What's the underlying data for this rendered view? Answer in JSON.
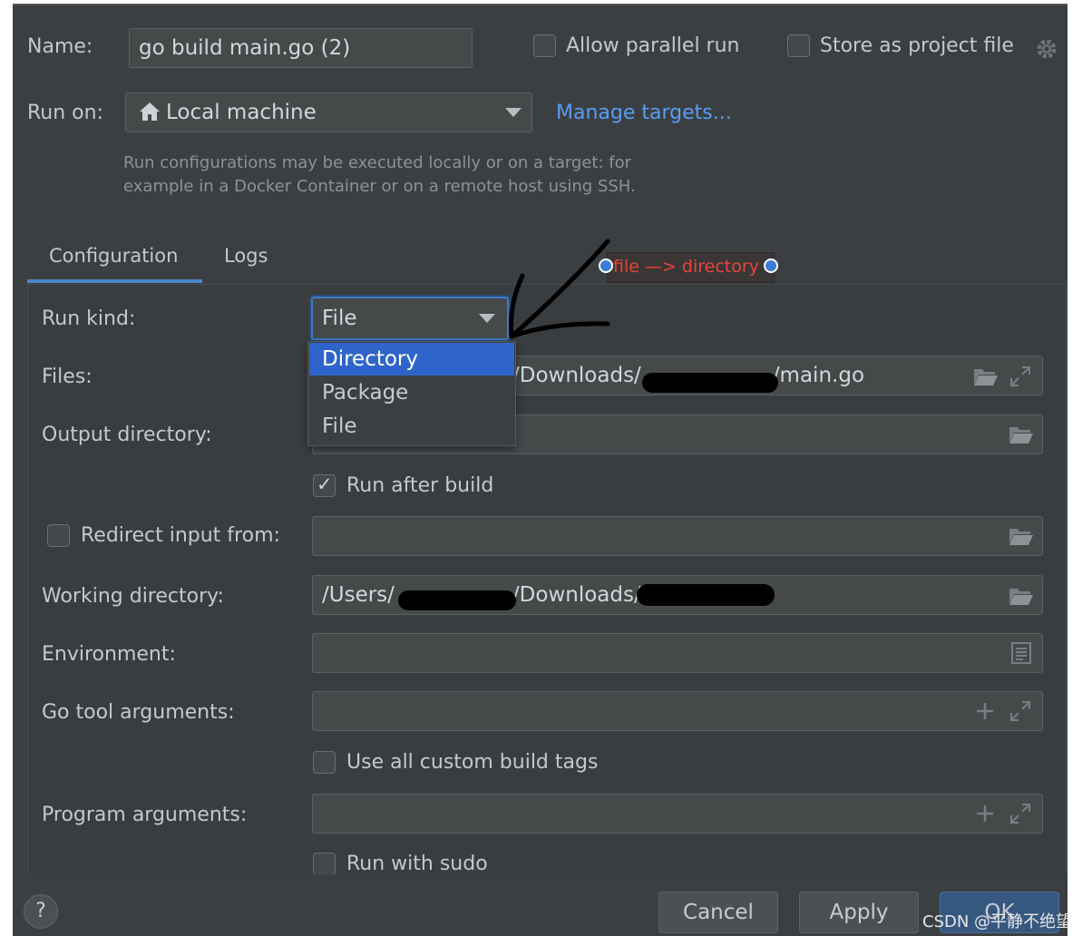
{
  "form": {
    "name_label": "Name:",
    "name_value": "go build main.go (2)",
    "allow_parallel_label": "Allow parallel run",
    "store_project_label": "Store as project file",
    "run_on_label": "Run on:",
    "run_on_value": "Local machine",
    "manage_targets": "Manage targets...",
    "hint_line1": "Run configurations may be executed locally or on a target: for",
    "hint_line2": "example in a Docker Container or on a remote host using SSH."
  },
  "tabs": [
    {
      "label": "Configuration",
      "active": true
    },
    {
      "label": "Logs",
      "active": false
    }
  ],
  "annotation": {
    "text": "file —> directory",
    "color": "#e8453c"
  },
  "config": {
    "run_kind_label": "Run kind:",
    "run_kind_value": "File",
    "run_kind_options": [
      "Directory",
      "Package",
      "File"
    ],
    "files_label": "Files:",
    "files_value_part1": "/Downloads/",
    "files_value_part2": "/main.go",
    "output_dir_label": "Output directory:",
    "output_dir_value": "",
    "run_after_build_label": "Run after build",
    "run_after_build_checked": true,
    "redirect_input_label": "Redirect input from:",
    "redirect_input_checked": false,
    "working_dir_label": "Working directory:",
    "working_dir_part1": "/Users/",
    "working_dir_part2": "/Downloads/",
    "environment_label": "Environment:",
    "go_tool_args_label": "Go tool arguments:",
    "use_custom_tags_label": "Use all custom build tags",
    "use_custom_tags_checked": false,
    "program_args_label": "Program arguments:",
    "run_with_sudo_label": "Run with sudo",
    "run_with_sudo_checked": false
  },
  "footer": {
    "help": "?",
    "cancel": "Cancel",
    "apply": "Apply",
    "ok": "OK",
    "watermark": "CSDN @平静不绝望"
  },
  "colors": {
    "background": "#3c3f41",
    "accent_blue": "#589df6",
    "selection": "#2f65ca",
    "annotation_red": "#e8453c"
  }
}
